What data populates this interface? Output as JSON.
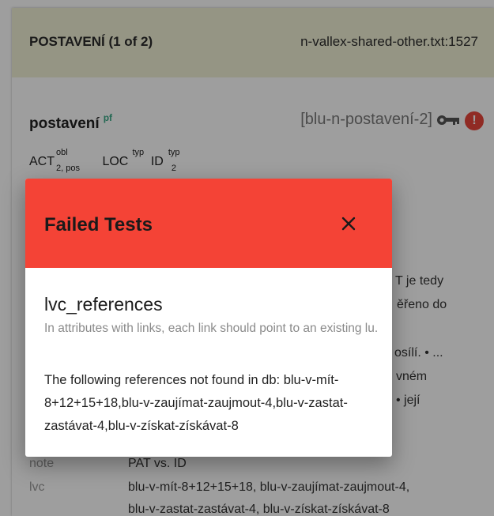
{
  "card": {
    "header_title": "POSTAVENÍ (1 of 2)",
    "header_source": "n-vallex-shared-other.txt:1527",
    "lemma": "postavení",
    "aspect": "pf",
    "lu_id": "[blu-n-postavení-2]",
    "frame": [
      {
        "functor": "ACT",
        "sup": "obl",
        "sub": "2, pos"
      },
      {
        "functor": "LOC",
        "sup": "typ",
        "sub": ""
      },
      {
        "functor": "ID",
        "sup": "typ",
        "sub": "2"
      }
    ],
    "peek_texts": [
      "T je tedy",
      "ěřeno do",
      "osílí. • ...",
      "vném",
      "• její"
    ],
    "attributes": [
      {
        "key": "note",
        "value": "PAT vs. ID"
      },
      {
        "key": "lvc",
        "value_lines": [
          "blu-v-mít-8+12+15+18, blu-v-zaujímat-zaujmout-4,",
          "blu-v-zastat-zastávat-4, blu-v-získat-získávat-8"
        ]
      }
    ],
    "colors": {
      "header_bg": "#f0f0d6",
      "aspect": "#3aa887",
      "alert": "#e8463b"
    }
  },
  "dialog": {
    "title": "Failed Tests",
    "test_name": "lvc_references",
    "test_description": "In attributes with links, each link should point to an existing lu.",
    "message": "The following references not found in db: blu-v-mít-8+12+15+18,blu-v-zaujímat-zaujmout-4,blu-v-zastat-zastávat-4,blu-v-získat-získávat-8",
    "colors": {
      "header_bg": "#f44336"
    }
  }
}
